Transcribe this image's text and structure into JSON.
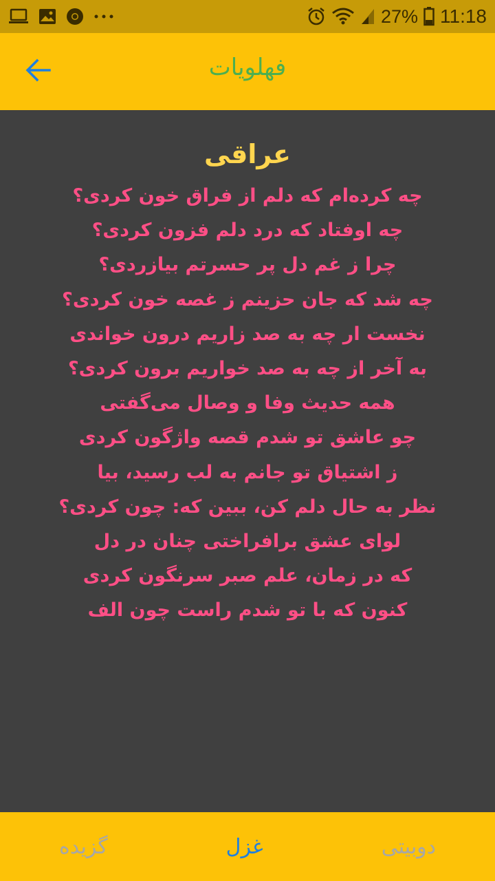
{
  "status_bar": {
    "battery": "27%",
    "time": "11:18",
    "left_icons": [
      "laptop-icon",
      "image-icon",
      "chrome-icon",
      "more-icon"
    ],
    "right_icons": [
      "alarm-icon",
      "wifi-icon",
      "signal-icon",
      "battery-icon"
    ]
  },
  "app_bar": {
    "title": "فهلویات",
    "back_icon": "arrow-left-icon"
  },
  "poem": {
    "title": "عراقی",
    "verses": [
      "چه کرده‌ام که دلم از فراق خون کردی؟",
      "چه اوفتاد که درد دلم فزون کردی؟",
      "چرا ز غم دل پر حسرتم بیازردی؟",
      "چه شد که جان حزینم ز غصه خون کردی؟",
      "نخست ار چه به صد زاریم درون خواندی",
      "به آخر از چه به صد خواریم برون کردی؟",
      "همه حدیث وفا و وصال می‌گفتی",
      "چو عاشق تو شدم قصه واژگون کردی",
      "ز اشتیاق تو جانم به لب رسید، بیا",
      "نظر به حال دلم کن، ببین که: چون کردی؟",
      "لوای عشق برافراختی چنان در دل",
      "که در زمان، علم صبر سرنگون کردی",
      "کنون که با تو شدم راست چون الف"
    ]
  },
  "bottom_nav": {
    "items": [
      {
        "label": "گزیده"
      },
      {
        "label": "غزل"
      },
      {
        "label": "دوبیتی"
      }
    ],
    "active": "غزل"
  },
  "colors": {
    "status_bar": "#c79b08",
    "app_bar": "#fdc207",
    "background": "#404040",
    "title_text": "#4caf50",
    "poem_title": "#ffd54f",
    "verse_text": "#ff4f86",
    "nav_active": "#1e7fe0",
    "nav_inactive": "#a7a7a7"
  }
}
